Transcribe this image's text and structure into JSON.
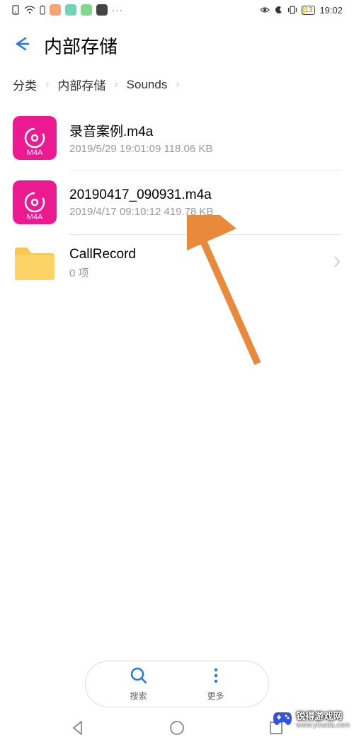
{
  "status": {
    "battery": "13",
    "time": "19:02"
  },
  "header": {
    "title": "内部存储"
  },
  "breadcrumb": {
    "items": [
      "分类",
      "内部存储",
      "Sounds"
    ]
  },
  "files": [
    {
      "icon_type": "m4a",
      "icon_label": "M4A",
      "name": "录音案例.m4a",
      "meta": "2019/5/29 19:01:09 118.06 KB",
      "has_chevron": false
    },
    {
      "icon_type": "m4a",
      "icon_label": "M4A",
      "name": "20190417_090931.m4a",
      "meta": "2019/4/17 09:10:12 419.78 KB",
      "has_chevron": false
    },
    {
      "icon_type": "folder",
      "icon_label": "",
      "name": "CallRecord",
      "meta": "0 项",
      "has_chevron": true
    }
  ],
  "bottom_actions": {
    "search": "搜索",
    "more": "更多"
  },
  "watermark": {
    "brand": "锐得游戏网",
    "url": "www.ytruida.com"
  },
  "annotation_color": "#e88a3a"
}
